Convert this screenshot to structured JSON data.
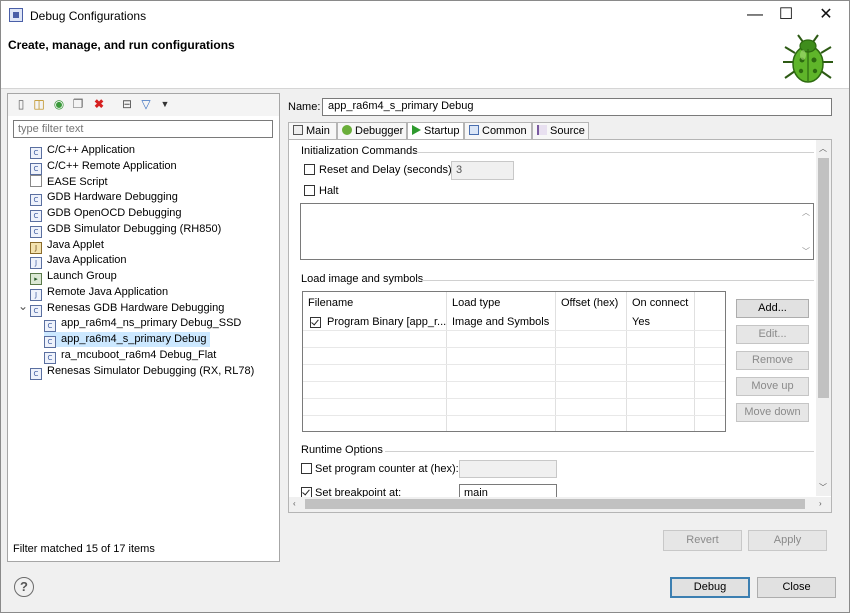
{
  "window": {
    "title": "Debug Configurations",
    "banner_title": "Create, manage, and run configurations",
    "controls": {
      "minimize": "—",
      "maximize": "☐",
      "close": "✕"
    }
  },
  "left": {
    "filter_placeholder": "type filter text",
    "tree": [
      {
        "label": "C/C++ Application",
        "icon": "c-launch-icon",
        "glyph": "C"
      },
      {
        "label": "C/C++ Remote Application",
        "icon": "c-launch-icon",
        "glyph": "C"
      },
      {
        "label": "EASE Script",
        "icon": "ease-script-icon",
        "glyph": ""
      },
      {
        "label": "GDB Hardware Debugging",
        "icon": "c-launch-icon",
        "glyph": "C"
      },
      {
        "label": "GDB OpenOCD Debugging",
        "icon": "c-launch-icon",
        "glyph": "C"
      },
      {
        "label": "GDB Simulator Debugging (RH850)",
        "icon": "c-launch-icon",
        "glyph": "C"
      },
      {
        "label": "Java Applet",
        "icon": "java-applet-icon",
        "glyph": "J"
      },
      {
        "label": "Java Application",
        "icon": "java-app-icon",
        "glyph": "J"
      },
      {
        "label": "Launch Group",
        "icon": "launch-group-icon",
        "glyph": "▸"
      },
      {
        "label": "Remote Java Application",
        "icon": "remote-java-icon",
        "glyph": "J"
      },
      {
        "label": "Renesas GDB Hardware Debugging",
        "icon": "c-launch-icon",
        "glyph": "C",
        "expanded": true
      },
      {
        "label": "app_ra6m4_ns_primary Debug_SSD",
        "icon": "c-launch-icon",
        "glyph": "C",
        "child": true
      },
      {
        "label": "app_ra6m4_s_primary Debug",
        "icon": "c-launch-icon",
        "glyph": "C",
        "child": true,
        "selected": true
      },
      {
        "label": "ra_mcuboot_ra6m4 Debug_Flat",
        "icon": "c-launch-icon",
        "glyph": "C",
        "child": true
      },
      {
        "label": "Renesas Simulator Debugging (RX, RL78)",
        "icon": "c-launch-icon",
        "glyph": "C"
      }
    ],
    "filter_status": "Filter matched 15 of 17 items"
  },
  "right": {
    "name_label": "Name:",
    "name_value": "app_ra6m4_s_primary Debug",
    "tabs": [
      "Main",
      "Debugger",
      "Startup",
      "Common",
      "Source"
    ],
    "active_tab": "Startup",
    "init": {
      "title": "Initialization Commands",
      "reset_label": "Reset and Delay (seconds):",
      "reset_value": "3",
      "halt_label": "Halt"
    },
    "load": {
      "title": "Load image and symbols",
      "columns": [
        "Filename",
        "Load type",
        "Offset (hex)",
        "On connect"
      ],
      "rows": [
        {
          "filename": "Program Binary [app_r...",
          "load_type": "Image and Symbols",
          "offset": "",
          "on_connect": "Yes",
          "checked": true
        }
      ],
      "buttons": {
        "add": "Add...",
        "edit": "Edit...",
        "remove": "Remove",
        "move_up": "Move up",
        "move_down": "Move down"
      }
    },
    "runtime": {
      "title": "Runtime Options",
      "pc_label": "Set program counter at (hex):",
      "pc_value": "",
      "bp_label": "Set breakpoint at:",
      "bp_value": "main"
    },
    "revert": "Revert",
    "apply": "Apply"
  },
  "footer": {
    "help": "?",
    "debug": "Debug",
    "close": "Close"
  },
  "colors": {
    "selection": "#cce8ff",
    "default_button_border": "#3c7fb1"
  }
}
